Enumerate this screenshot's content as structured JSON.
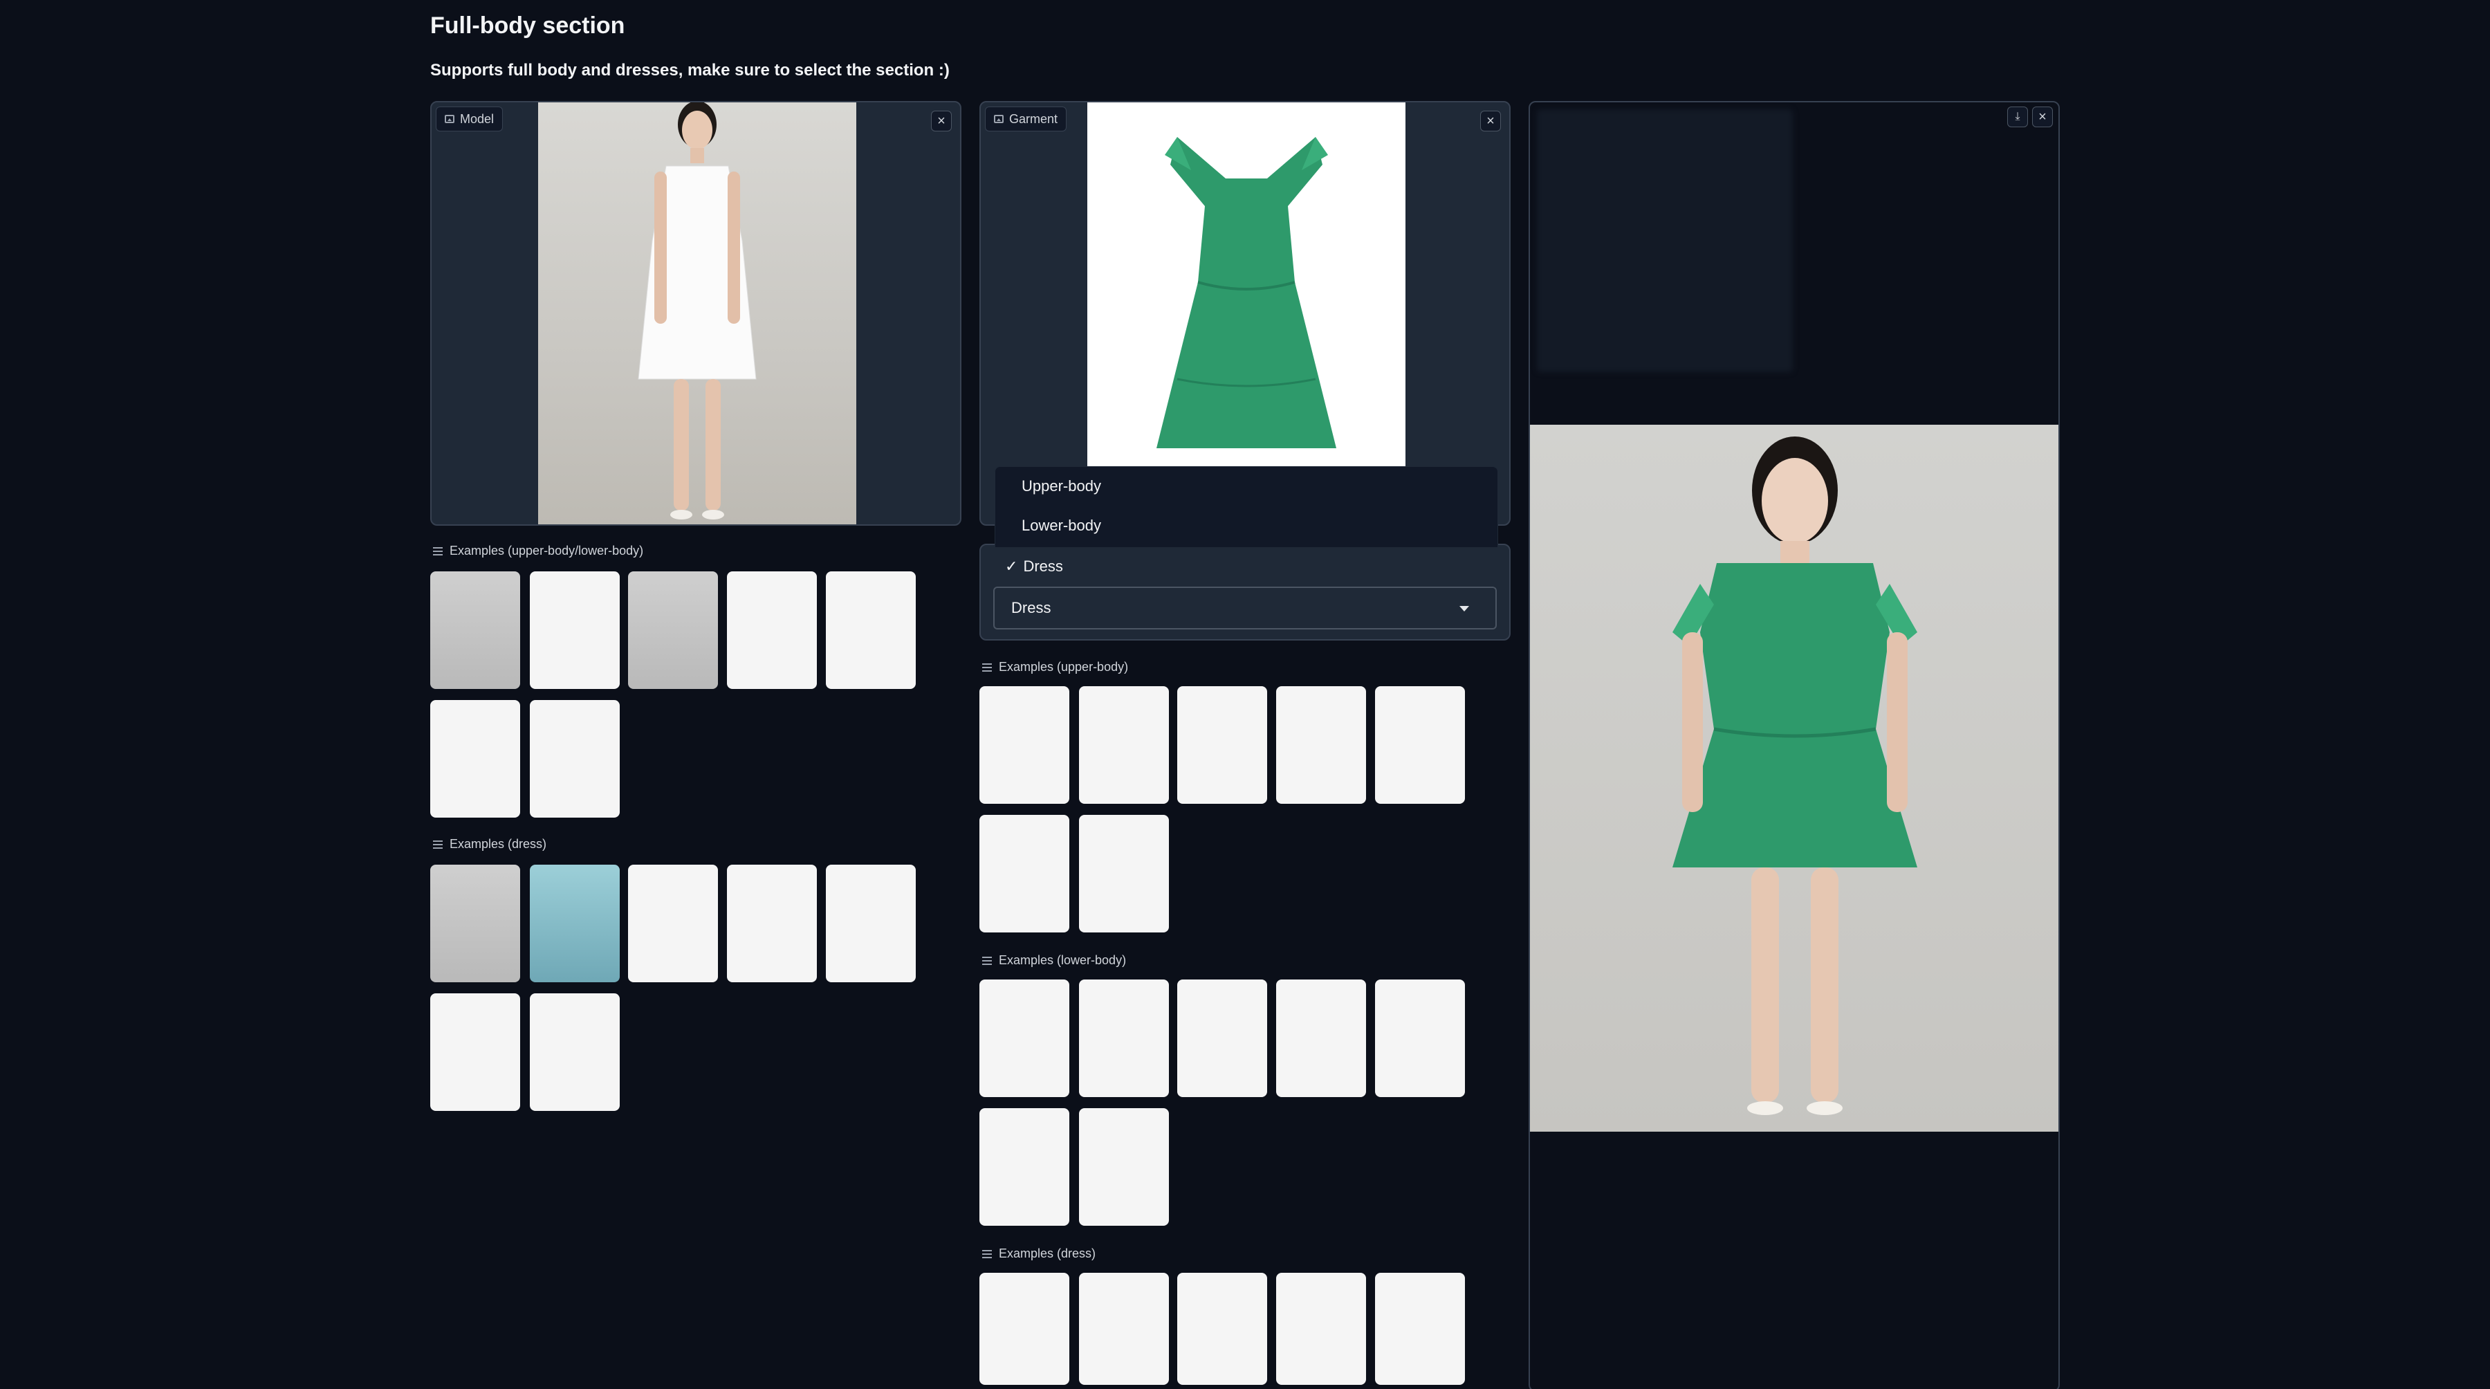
{
  "page": {
    "title": "Full-body section",
    "subtitle": "Supports full body and dresses, make sure to select the section :)"
  },
  "model_panel": {
    "label": "Model",
    "clear_icon": "close-icon"
  },
  "garment_panel": {
    "label": "Garment",
    "clear_icon": "close-icon"
  },
  "result_panel": {
    "download_icon": "download-icon",
    "clear_icon": "close-icon"
  },
  "category": {
    "options": [
      "Upper-body",
      "Lower-body",
      "Dress"
    ],
    "selected": "Dress",
    "check_mark": "✓"
  },
  "left_examples": {
    "upper_lower_label": "Examples (upper-body/lower-body)",
    "dress_label": "Examples (dress)"
  },
  "right_examples": {
    "upper_label": "Examples (upper-body)",
    "lower_label": "Examples (lower-body)",
    "dress_label": "Examples (dress)"
  },
  "colors": {
    "background": "#0b0f19",
    "panel": "#1f2937",
    "garment_green": "#2e9a6b"
  }
}
